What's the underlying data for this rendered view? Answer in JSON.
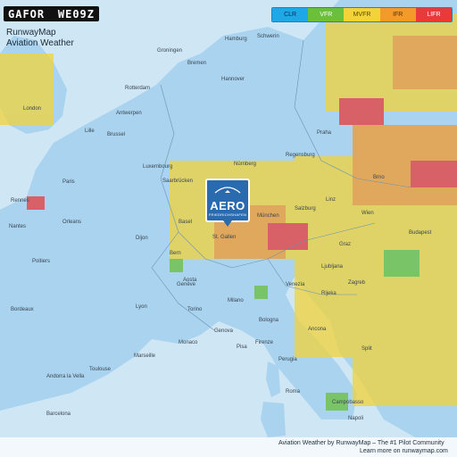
{
  "badge": {
    "left": "GAFOR",
    "right": "WE09Z"
  },
  "brand": {
    "line1": "RunwayMap",
    "line2": "Aviation Weather"
  },
  "legend": [
    {
      "label": "CLR",
      "color": "#1ea8e6",
      "text": "#0d2a4f"
    },
    {
      "label": "VFR",
      "color": "#6bbf3b",
      "text": "#ffffff"
    },
    {
      "label": "MVFR",
      "color": "#f2d43a",
      "text": "#5a4700"
    },
    {
      "label": "IFR",
      "color": "#f39a2b",
      "text": "#5a2e00"
    },
    {
      "label": "LIFR",
      "color": "#e83a3a",
      "text": "#ffffff"
    }
  ],
  "aero": {
    "word": "AERO",
    "sub": "FRIEDRICHSHAFEN"
  },
  "footer": {
    "line1": "Aviation Weather by RunwayMap – The #1 Pilot Community",
    "line2": "Learn more on runwaymap.com"
  },
  "cities": [
    "Hamburg",
    "Schwerin",
    "Groningen",
    "Bremen",
    "Hannover",
    "London",
    "Rotterdam",
    "Antwerpen",
    "Brussel",
    "Luxembourg",
    "Saarbrücken",
    "Paris",
    "Stuttgart",
    "Nürnberg",
    "Regensburg",
    "München",
    "St. Gallen",
    "Orleans",
    "Poitiers",
    "Bordeaux",
    "Genève",
    "Lyon",
    "Torino",
    "Milano",
    "Monaco",
    "Marseille",
    "Andorra la Vella",
    "Barcelona",
    "Firenze",
    "Perugia",
    "Roma",
    "Napoli",
    "Campobasso",
    "Zagreb",
    "Budapest",
    "Split",
    "Wien",
    "Salzburg",
    "Linz",
    "Venezia",
    "Bologna",
    "Toulouse",
    "Nantes",
    "Rennes",
    "Lille",
    "Dijon",
    "Basel",
    "Bern",
    "Aosta",
    "Genova",
    "Pisa",
    "Ancona",
    "Ljubljana",
    "Rijeka",
    "Brno",
    "Praha",
    "Graz"
  ],
  "colors": {
    "water": "#cfe6f5",
    "land": "#a9d3ef"
  }
}
